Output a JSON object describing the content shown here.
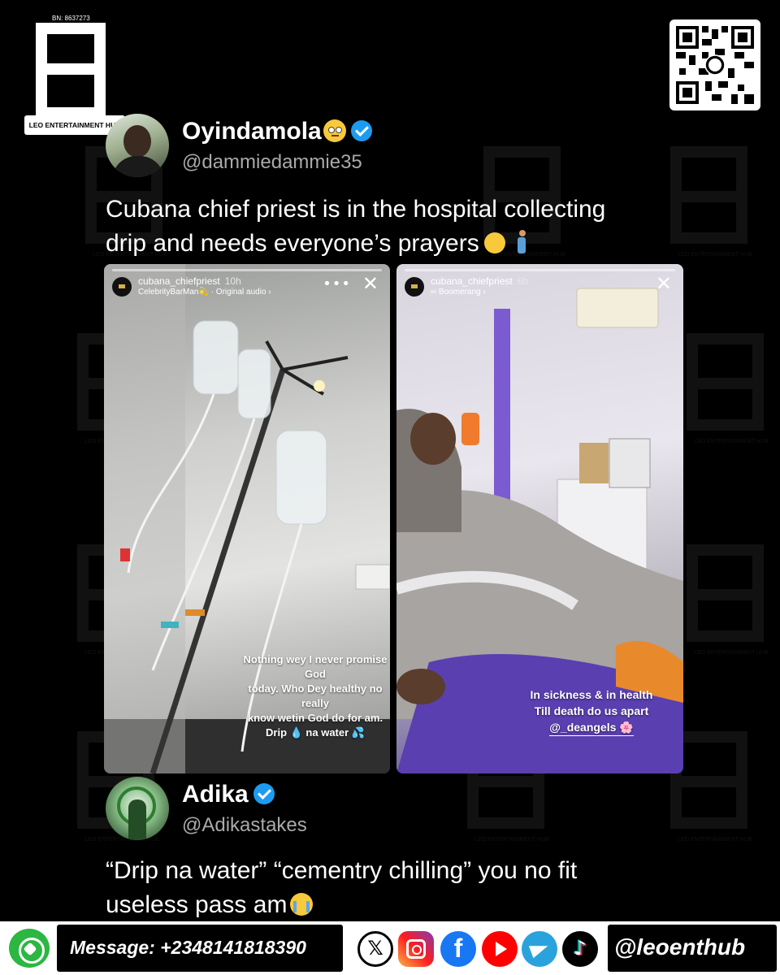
{
  "brand": {
    "reg_number": "BN: 8637273",
    "name": "LEO ENTERTAINMENT HUB"
  },
  "tweet1": {
    "name": "Oyindamola",
    "handle": "@dammiedammie35",
    "text_line1": "Cubana chief priest is in the hospital collecting",
    "text_line2": "drip and needs everyone’s prayers"
  },
  "story_left": {
    "username": "cubana_chiefpriest",
    "time": "10h",
    "audio": "CelebrityBarMan💫 · Original audio ›",
    "caption_lines": [
      "Nothing wey I never promise God",
      "today. Who Dey healthy no really",
      "know wetin God do for am.",
      "Drip 💧 na water 💦"
    ]
  },
  "story_right": {
    "username": "cubana_chiefpriest",
    "time": "6h",
    "audio": "∞ Boomerang ›",
    "caption_lines": [
      "In sickness & in health",
      "Till death do us apart"
    ],
    "mention": "@_deangels 🌸"
  },
  "tweet2": {
    "name": "Adika",
    "handle": "@Adikastakes",
    "text_line1": "“Drip na water” “cementry chilling” you no fit",
    "text_line2": "useless pass am"
  },
  "footer": {
    "message": "Message: +2348141818390",
    "handle": "@leoenthub",
    "icons": [
      "whatsapp-icon",
      "x-icon",
      "instagram-icon",
      "facebook-icon",
      "youtube-icon",
      "telegram-icon",
      "tiktok-icon"
    ]
  },
  "colors": {
    "background": "#000000",
    "verified": "#1d9bf0",
    "whatsapp": "#2bb741"
  }
}
